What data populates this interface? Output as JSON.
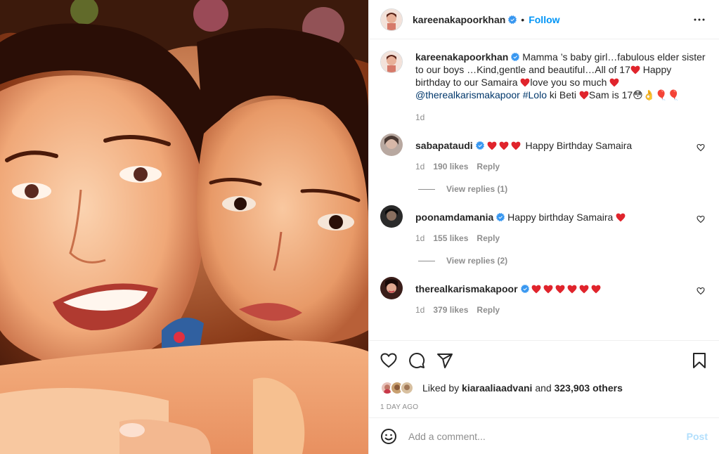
{
  "post": {
    "username": "kareenakapoorkhan",
    "follow_label": "Follow",
    "dot": "•",
    "more_icon": "more-options-icon"
  },
  "caption": {
    "username": "kareenakapoorkhan",
    "text_1": "Mamma ’s baby girl…fabulous elder sister to our boys …Kind,gentle and beautiful…All of 17",
    "text_2": "Happy birthday to our Samaira",
    "text_3": "love you so much",
    "mention": "@therealkarismakapoor",
    "hashtag": "#Lolo",
    "text_4": "ki Beti",
    "text_5": "Sam is 17😳👌🎈🎈",
    "time": "1d"
  },
  "comments": [
    {
      "username": "sabapataudi",
      "text": "Happy Birthday Samaira",
      "hearts": 3,
      "time": "1d",
      "likes": "190 likes",
      "reply": "Reply",
      "view_replies": "View replies (1)"
    },
    {
      "username": "poonamdamania",
      "text": "Happy birthday Samaira",
      "hearts": 1,
      "time": "1d",
      "likes": "155 likes",
      "reply": "Reply",
      "view_replies": "View replies (2)"
    },
    {
      "username": "therealkarismakapoor",
      "text": "",
      "hearts": 6,
      "time": "1d",
      "likes": "379 likes",
      "reply": "Reply"
    }
  ],
  "likes": {
    "prefix": "Liked by",
    "user": "kiaraaliaadvani",
    "middle": "and",
    "count": "323,903 others"
  },
  "timestamp": "1 DAY AGO",
  "add_comment": {
    "placeholder": "Add a comment...",
    "post_label": "Post"
  },
  "colors": {
    "accent": "#0095f6",
    "heart_red": "#ed4956",
    "verified": "#3897f0",
    "muted": "#8e8e8e",
    "post_disabled": "#b2dffc"
  }
}
